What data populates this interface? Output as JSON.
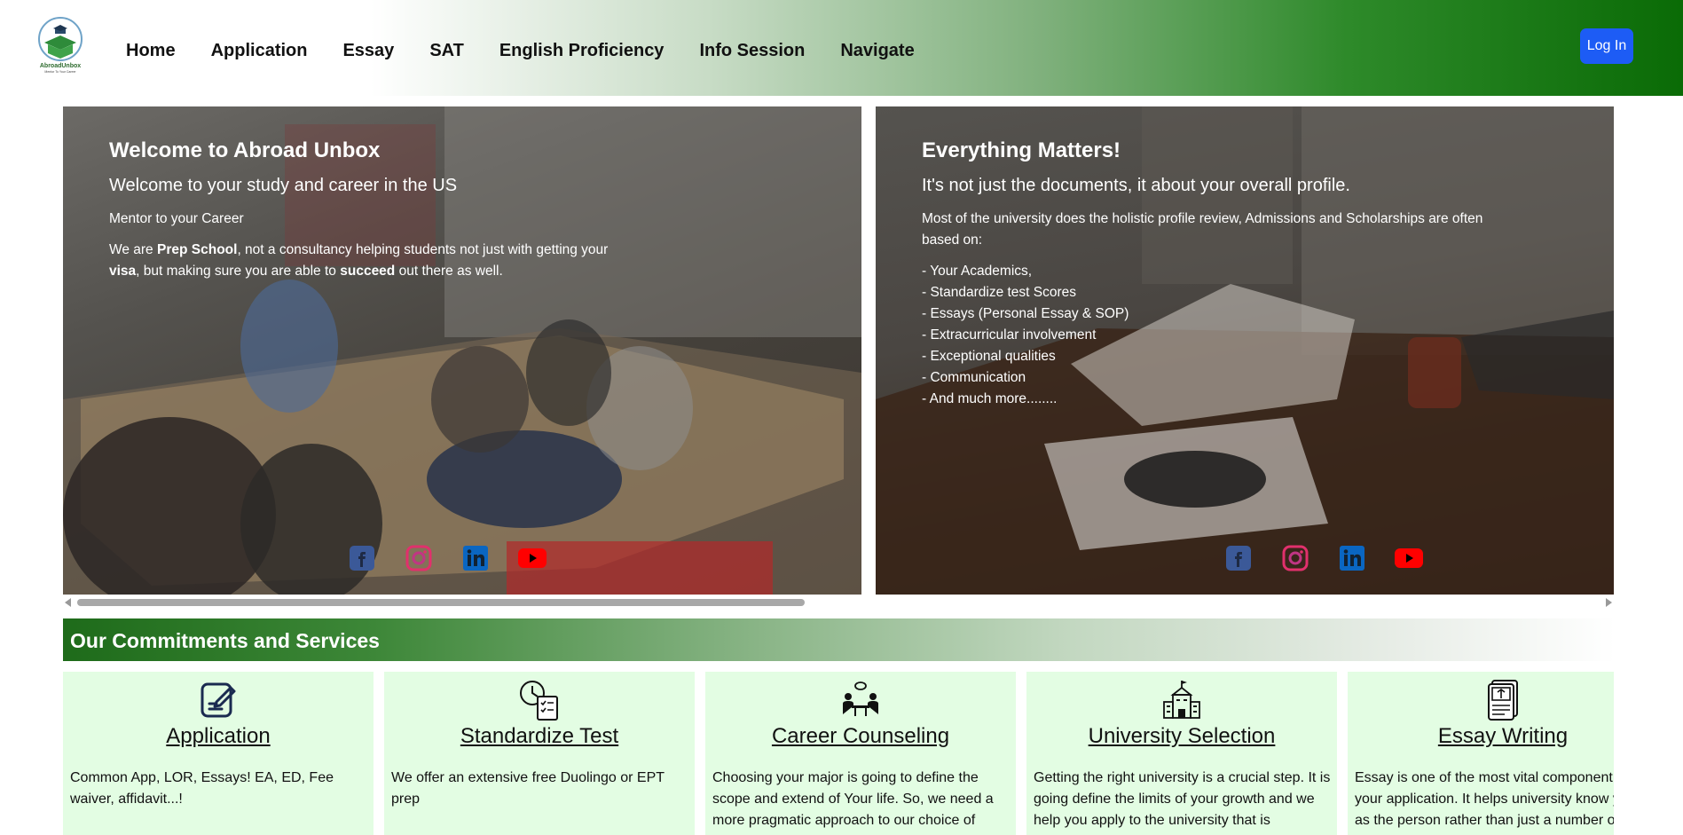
{
  "header": {
    "logo_text": "AbroadUnbox",
    "logo_tagline": "Mentor To Your Career",
    "nav": [
      "Home",
      "Application",
      "Essay",
      "SAT",
      "English Proficiency",
      "Info Session",
      "Navigate"
    ],
    "login_label": "Log In"
  },
  "slides": [
    {
      "title": "Welcome to Abroad Unbox",
      "subtitle": "Welcome to your study and career in the US",
      "tagline": "Mentor to your Career",
      "body_pre": "We are ",
      "body_bold1": "Prep School",
      "body_mid1": ", not a consultancy helping students not just with getting your ",
      "body_bold2": "visa",
      "body_mid2": ", but making sure you are able to ",
      "body_bold3": "succeed",
      "body_post": " out there as well."
    },
    {
      "title": "Everything Matters!",
      "subtitle": "It's not just the documents, it about your overall profile.",
      "body": "Most of the university does the holistic profile review, Admissions and Scholarships are often based on:",
      "list": [
        "- Your Academics,",
        "- Standardize test Scores",
        "- Essays (Personal Essay & SOP)",
        "- Extracurricular involvement",
        "- Exceptional qualities",
        "- Communication",
        "- And much more........"
      ]
    }
  ],
  "socials": [
    "facebook-icon",
    "instagram-icon",
    "linkedin-icon",
    "youtube-icon"
  ],
  "section": {
    "title": "Our Commitments and Services"
  },
  "cards": [
    {
      "icon": "application-edit-icon",
      "title": "Application",
      "desc": "Common App, LOR, Essays! EA, ED, Fee waiver, affidavit...!"
    },
    {
      "icon": "clock-checklist-icon",
      "title": "Standardize Test",
      "desc": "We offer an extensive free Duolingo or EPT prep"
    },
    {
      "icon": "counseling-icon",
      "title": "Career Counseling",
      "desc": "Choosing your major is going to define the scope and extend of Your life. So, we need a more pragmatic approach to our choice of"
    },
    {
      "icon": "university-icon",
      "title": "University Selection",
      "desc": "Getting the right university is a crucial step. It is going define the limits of your growth and we help you apply to the university that is"
    },
    {
      "icon": "essay-document-icon",
      "title": "Essay Writing",
      "desc": "Essay is one of the most vital component of your application. It helps university know you as the person rather than just a number on"
    }
  ],
  "colors": {
    "header_green": "#0a6b06",
    "login_blue": "#1d5cf5",
    "card_bg": "#e3fde3",
    "section_green": "#1e6b1a"
  }
}
